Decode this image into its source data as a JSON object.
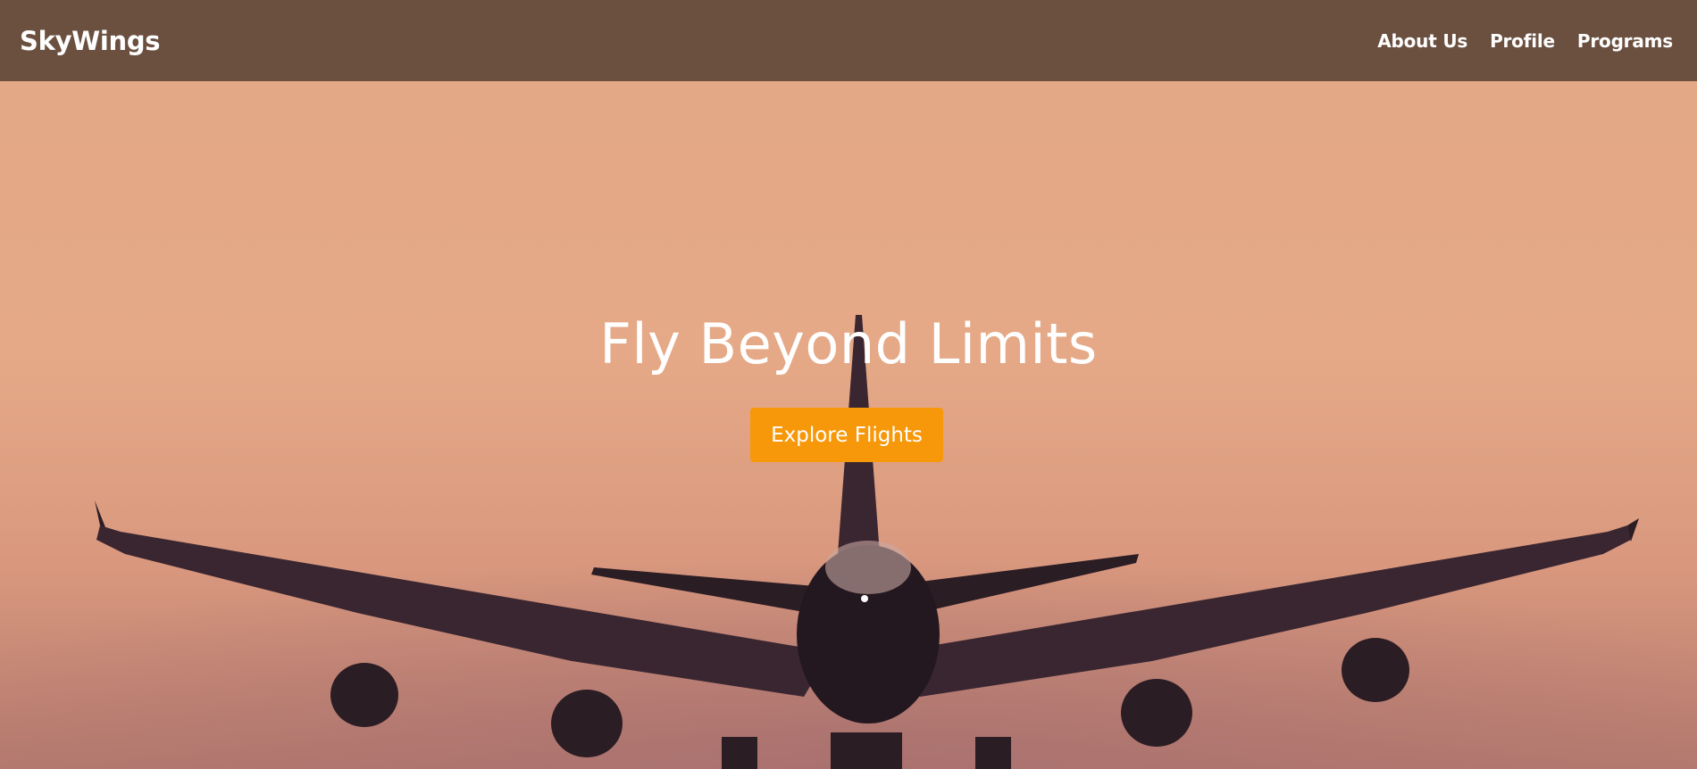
{
  "nav": {
    "brand": "SkyWings",
    "links": [
      "About Us",
      "Profile",
      "Programs"
    ]
  },
  "hero": {
    "title": "Fly Beyond Limits",
    "cta_label": "Explore Flights",
    "image": "airplane-landing-at-sunset"
  },
  "colors": {
    "navbar_bg": "#6b5040",
    "cta_bg": "#f7980a",
    "sky": "#e4a888",
    "airplane": "#2a1c22"
  }
}
